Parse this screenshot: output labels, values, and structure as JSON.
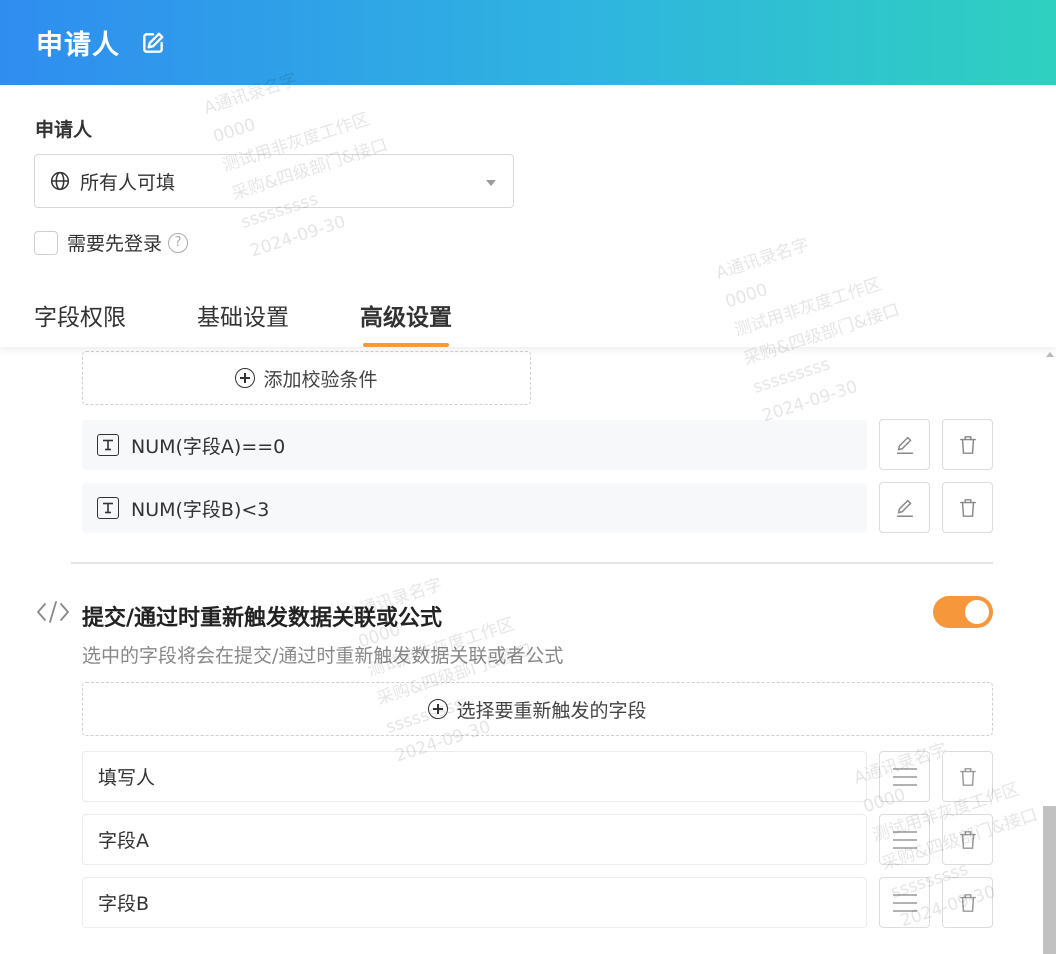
{
  "header": {
    "title": "申请人"
  },
  "panel": {
    "field_label": "申请人",
    "visibility_value": "所有人可填",
    "login_label": "需要先登录",
    "help_glyph": "?"
  },
  "tabs": [
    {
      "label": "字段权限"
    },
    {
      "label": "基础设置"
    },
    {
      "label": "高级设置"
    }
  ],
  "validation": {
    "add_button": "添加校验条件",
    "rules": [
      {
        "formula": "NUM(字段A)==0"
      },
      {
        "formula": "NUM(字段B)<3"
      }
    ]
  },
  "retrigger": {
    "title": "提交/通过时重新触发数据关联或公式",
    "description": "选中的字段将会在提交/通过时重新触发数据关联或者公式",
    "enabled": true,
    "select_button": "选择要重新触发的字段",
    "fields": [
      {
        "label": "填写人"
      },
      {
        "label": "字段A"
      },
      {
        "label": "字段B"
      }
    ]
  },
  "watermark": {
    "lines": [
      "A通讯录名字",
      "0000",
      "测试用非灰度工作区",
      "采购&四级部门&接口",
      "sssssssss",
      "2024-09-30"
    ]
  },
  "colors": {
    "accent": "#f5973a",
    "header_start": "#2f8df0",
    "header_end": "#2fd0c0"
  }
}
